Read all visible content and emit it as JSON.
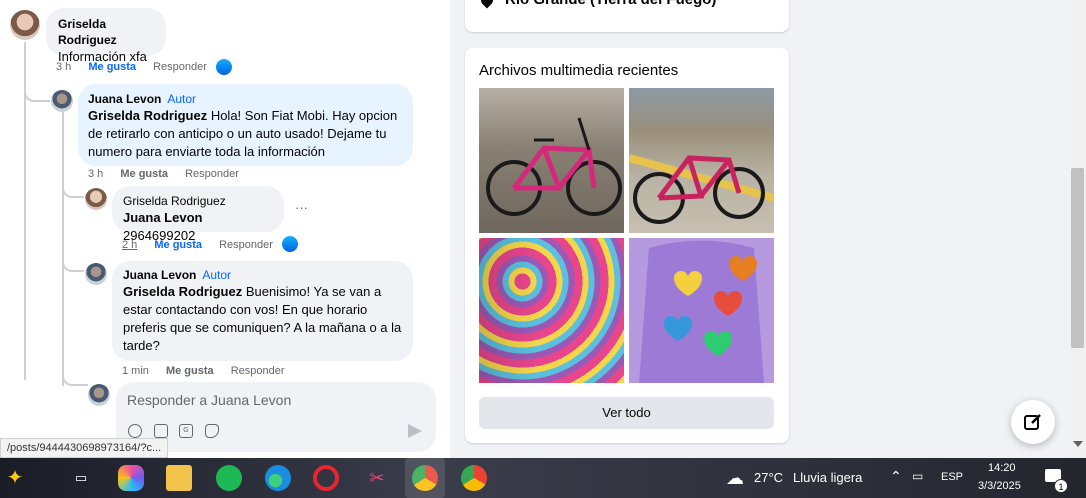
{
  "comments": {
    "c1": {
      "author": "Griselda Rodriguez",
      "text": "Información xfa",
      "time": "3 h",
      "like": "Me gusta",
      "reply": "Responder"
    },
    "c2": {
      "author": "Juana Levon",
      "tag": "Autor",
      "mention": "Griselda Rodriguez",
      "text": " Hola! Son Fiat Mobi. Hay opcion de retirarlo con anticipo o un auto usado! Dejame tu numero para enviarte toda la información",
      "time": "3 h",
      "like": "Me gusta",
      "reply": "Responder"
    },
    "c3": {
      "author": "Griselda Rodriguez",
      "mention": "Juana Levon",
      "text": " 2964699202",
      "time": "2 h",
      "like": "Me gusta",
      "reply": "Responder",
      "more": "···"
    },
    "c4": {
      "author": "Juana Levon",
      "tag": "Autor",
      "mention": "Griselda Rodriguez",
      "text": " Buenisimo! Ya se van a estar contactando con vos! En que horario preferis que se comuniquen? A la mañana o a la tarde?",
      "time": "1 min",
      "like": "Me gusta",
      "reply": "Responder"
    }
  },
  "reply_box": {
    "placeholder": "Responder a Juana Levon"
  },
  "status_url": "/posts/9444430698973164/?c...",
  "location_card": {
    "text": "Río Grande (Tierra del Fuego)"
  },
  "media_card": {
    "title": "Archivos multimedia recientes",
    "button": "Ver todo"
  },
  "taskbar": {
    "weather": "27°C",
    "weather_desc": "Lluvia ligera",
    "lang": "ESP",
    "time": "14:20",
    "date": "3/3/2025",
    "notif_count": "1"
  },
  "icons": [
    "like-icon",
    "send-icon",
    "camera-icon",
    "gif-icon",
    "sticker-icon",
    "emoji-icon",
    "compose-icon",
    "location-pin-icon"
  ],
  "colors": {
    "accent": "#0866ff",
    "bubble": "#f0f2f5",
    "bubble_highlight": "#e7f3ff"
  }
}
